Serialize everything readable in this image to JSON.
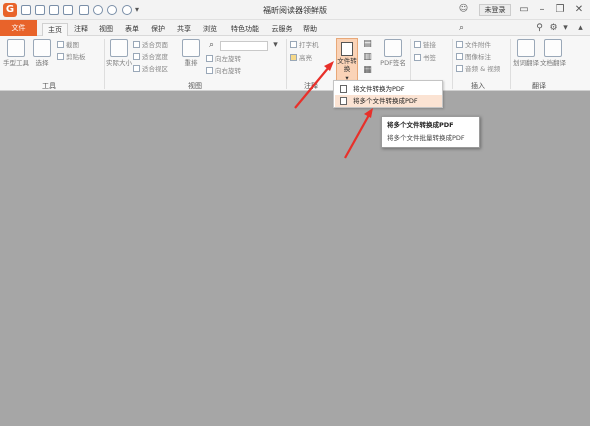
{
  "app": {
    "logo_letter": "G",
    "title": "福昕阅读器领鲜版",
    "login_label": "未登录"
  },
  "tabs": [
    {
      "label": "文件"
    },
    {
      "label": "主页"
    },
    {
      "label": "注释"
    },
    {
      "label": "视图"
    },
    {
      "label": "表单"
    },
    {
      "label": "保护"
    },
    {
      "label": "共享"
    },
    {
      "label": "浏览"
    },
    {
      "label": "特色功能"
    },
    {
      "label": "云服务"
    },
    {
      "label": "帮助"
    }
  ],
  "search": {
    "placeholder": "查找"
  },
  "ribbon": {
    "tools": {
      "hand": "手型工具",
      "select": "选择",
      "snapshot": "截图",
      "clipboard": "剪贴板",
      "group": "工具"
    },
    "view": {
      "actual_size": "实际大小",
      "fit_page": "适合页面",
      "fit_width": "适合宽度",
      "fit_visible": "适合视区",
      "reflow": "重排",
      "rotate_left": "向左旋转",
      "rotate_right": "向右旋转",
      "group": "视图"
    },
    "annotate": {
      "typewriter": "打字机",
      "highlight": "高亮",
      "group": "注释"
    },
    "convert": {
      "button": "文件转换",
      "pdf_sign": "PDF签名"
    },
    "links": {
      "link": "链接",
      "bookmark": "书签"
    },
    "insert": {
      "attachment": "文件附件",
      "image": "图像标注",
      "audio_video": "音频 & 视频",
      "group": "插入"
    },
    "translate": {
      "word": "划词翻译",
      "doc": "文档翻译",
      "group": "翻译"
    }
  },
  "dropdown": {
    "items": [
      {
        "label": "将文件转换为PDF"
      },
      {
        "label": "将多个文件转换成PDF"
      }
    ]
  },
  "tooltip": {
    "title": "将多个文件转换成PDF",
    "desc": "将多个文件批量转换成PDF"
  },
  "colors": {
    "accent": "#e8632a",
    "highlight": "#fbe3d3",
    "arrow": "#e8302a",
    "doc_bg": "#a6a6a6"
  }
}
